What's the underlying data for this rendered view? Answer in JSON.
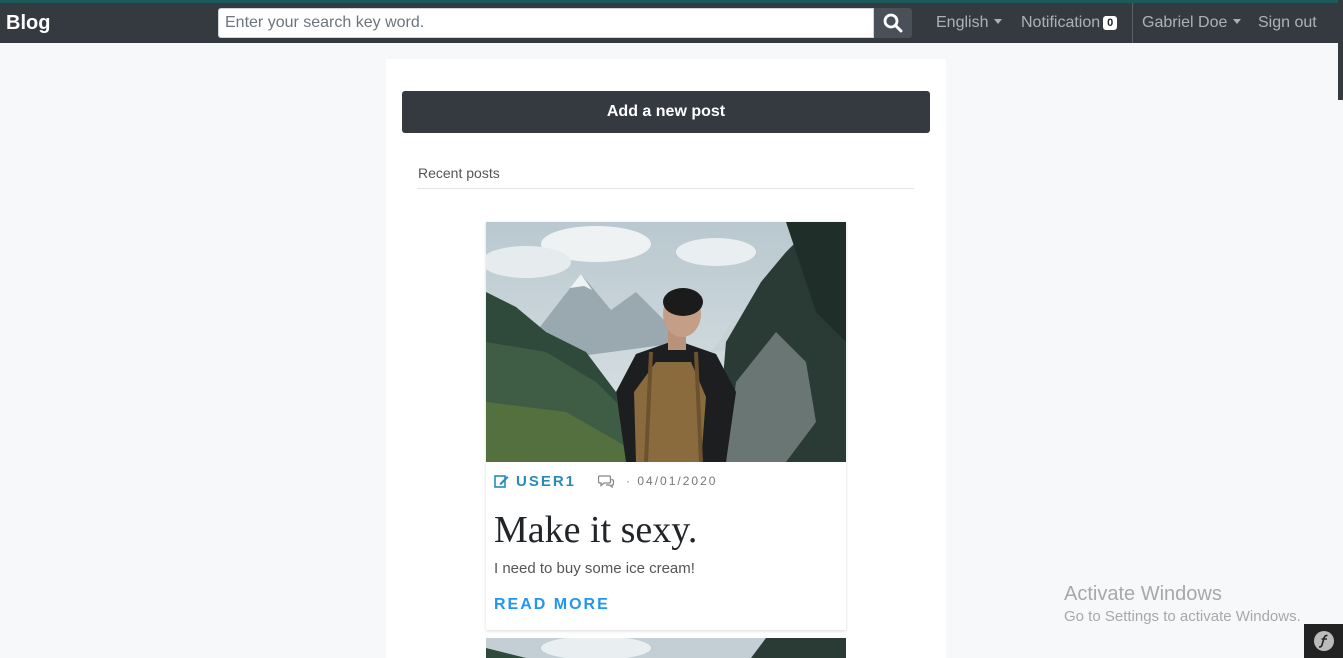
{
  "navbar": {
    "brand": "Blog",
    "search": {
      "placeholder": "Enter your search key word.",
      "value": "",
      "icon": "search-icon"
    },
    "language": "English",
    "notification": {
      "label": "Notification",
      "count": "0"
    },
    "user": "Gabriel Doe",
    "signout": "Sign out"
  },
  "main": {
    "add_post_label": "Add a new post",
    "section_title": "Recent posts",
    "posts": [
      {
        "author": "USER1",
        "date": "· 04/01/2020",
        "title": "Make it sexy.",
        "excerpt": "I need to buy some ice cream!",
        "read_more": "READ MORE",
        "author_icon": "edit-icon",
        "comments_icon": "comments-icon"
      }
    ]
  },
  "watermark": {
    "title": "Activate Windows",
    "subtitle": "Go to Settings to activate Windows."
  },
  "colors": {
    "navbar": "#343a40",
    "accent_author": "#2a8bb8",
    "accent_link": "#2196f3",
    "background": "#f7f8fa"
  }
}
